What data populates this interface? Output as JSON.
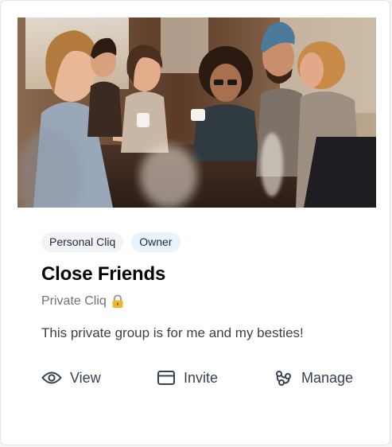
{
  "card": {
    "image_alt": "Group of friends laughing over coffee at a cafe",
    "tags": [
      {
        "label": "Personal Cliq",
        "style": "grey"
      },
      {
        "label": "Owner",
        "style": "blue"
      }
    ],
    "title": "Close Friends",
    "subtitle": "Private Cliq",
    "subtitle_icon": "lock-icon",
    "description": "This private group is for me and my besties!",
    "actions": [
      {
        "label": "View",
        "icon": "eye-icon"
      },
      {
        "label": "Invite",
        "icon": "card-icon"
      },
      {
        "label": "Manage",
        "icon": "manage-icon"
      }
    ]
  },
  "colors": {
    "tag_grey_bg": "#f1f3f6",
    "tag_blue_bg": "#e8f4fb",
    "title": "#000000",
    "muted_text": "#71717a",
    "action_text": "#374151"
  }
}
